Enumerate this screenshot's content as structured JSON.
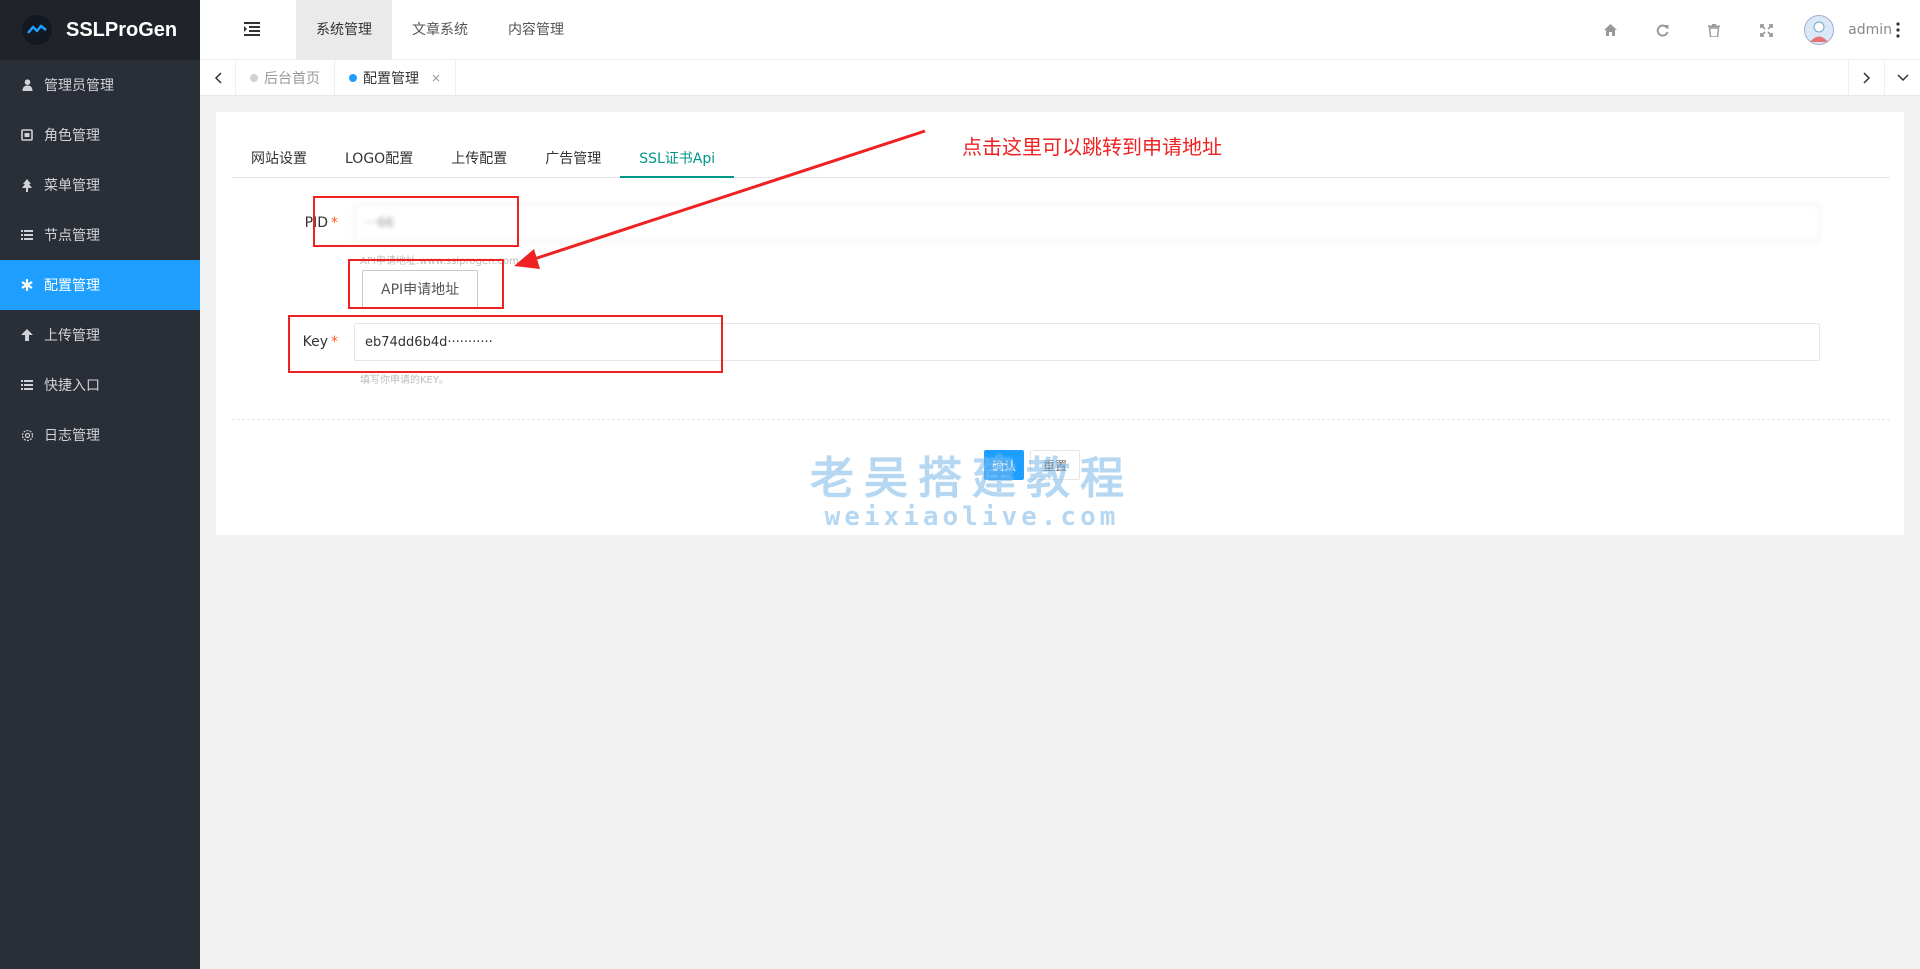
{
  "app": {
    "logo_text": "SSLProGen"
  },
  "sidebar": {
    "items": [
      {
        "label": "管理员管理",
        "icon": "user-icon"
      },
      {
        "label": "角色管理",
        "icon": "id-card-icon"
      },
      {
        "label": "菜单管理",
        "icon": "tree-icon"
      },
      {
        "label": "节点管理",
        "icon": "list-icon"
      },
      {
        "label": "配置管理",
        "icon": "gear-icon",
        "active": true
      },
      {
        "label": "上传管理",
        "icon": "arrow-up-icon"
      },
      {
        "label": "快捷入口",
        "icon": "list-icon"
      },
      {
        "label": "日志管理",
        "icon": "cog-outline-icon"
      }
    ]
  },
  "header": {
    "nav": [
      {
        "label": "系统管理",
        "active": true
      },
      {
        "label": "文章系统"
      },
      {
        "label": "内容管理"
      }
    ],
    "icons": [
      "home-icon",
      "refresh-icon",
      "trash-icon",
      "fullscreen-icon"
    ],
    "user_name": "admin"
  },
  "tabs": [
    {
      "label": "后台首页",
      "active": false
    },
    {
      "label": "配置管理",
      "active": true,
      "close": "×"
    }
  ],
  "settings_tabs": [
    {
      "label": "网站设置"
    },
    {
      "label": "LOGO配置"
    },
    {
      "label": "上传配置"
    },
    {
      "label": "广告管理"
    },
    {
      "label": "SSL证书Api",
      "active": true
    }
  ],
  "form": {
    "pid": {
      "label": "PID",
      "required_mark": "*",
      "value": "···66",
      "helper": "API申请地址:www.sslprogen.com"
    },
    "api_button": "API申请地址",
    "key": {
      "label": "Key",
      "required_mark": "*",
      "value": "eb74dd6b4d···········",
      "helper": "填写你申请的KEY。"
    },
    "submit_label": "确认",
    "reset_label": "重置"
  },
  "annotation": {
    "text": "点击这里可以跳转到申请地址",
    "color": "#ee2222"
  },
  "watermark": {
    "line1": "老吴搭建教程",
    "line2": "weixiaolive.com"
  },
  "colors": {
    "accent": "#1e9fff",
    "tab_active": "#009688",
    "sidebar_bg": "#2a2e36"
  }
}
